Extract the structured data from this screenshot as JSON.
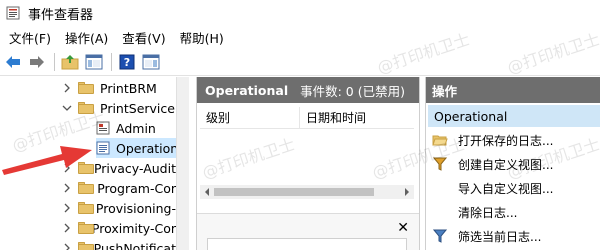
{
  "window": {
    "title": "事件查看器"
  },
  "menu": {
    "items": [
      "文件(F)",
      "操作(A)",
      "查看(V)",
      "帮助(H)"
    ]
  },
  "tree": {
    "items": [
      {
        "label": "PrintBRM",
        "kind": "folder",
        "expander": "closed"
      },
      {
        "label": "PrintService",
        "kind": "folder",
        "expander": "open"
      },
      {
        "label": "Admin",
        "kind": "log",
        "expander": "none"
      },
      {
        "label": "Operation",
        "kind": "log",
        "expander": "none",
        "selected": true
      },
      {
        "label": "Privacy-Audit",
        "kind": "folder",
        "expander": "closed"
      },
      {
        "label": "Program-Cor",
        "kind": "folder",
        "expander": "closed"
      },
      {
        "label": "Provisioning-",
        "kind": "folder",
        "expander": "closed"
      },
      {
        "label": "Proximity-Cor",
        "kind": "folder",
        "expander": "closed"
      },
      {
        "label": "PushNotificat",
        "kind": "folder",
        "expander": "closed"
      }
    ]
  },
  "middle": {
    "header_title": "Operational",
    "header_info": "事件数: 0 (已禁用)",
    "columns": [
      "级别",
      "日期和时间"
    ]
  },
  "actions": {
    "header": "操作",
    "selected": "Operational",
    "items": [
      {
        "label": "打开保存的日志...",
        "icon": "folder-open-icon"
      },
      {
        "label": "创建自定义视图...",
        "icon": "filter-icon"
      },
      {
        "label": "导入自定义视图...",
        "icon": "none"
      },
      {
        "label": "清除日志...",
        "icon": "none"
      },
      {
        "label": "筛选当前日志...",
        "icon": "filter-icon"
      }
    ]
  },
  "watermark": "@打印机卫士",
  "colors": {
    "header_bg": "#6e6e6e",
    "selection": "#cce8ff",
    "arrow": "#e53935",
    "folder": "#e8c36a"
  }
}
